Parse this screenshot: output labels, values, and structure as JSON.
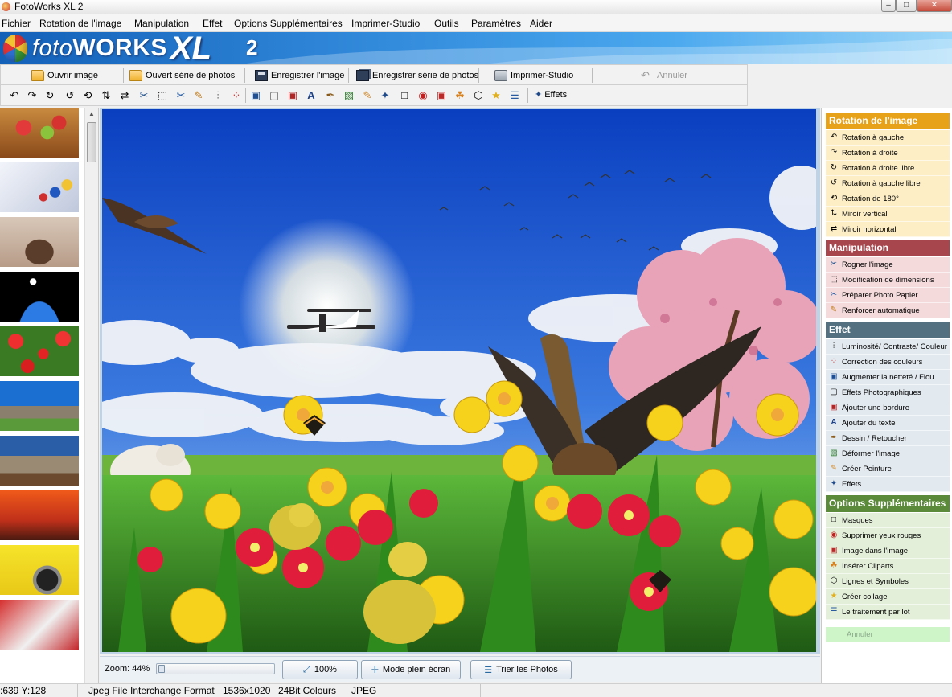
{
  "window": {
    "title": "FotoWorks XL 2",
    "controls": [
      "–",
      "□",
      "✕"
    ]
  },
  "menu": [
    "Fichier",
    "Rotation de l'image",
    "Manipulation",
    "Effet",
    "Options Supplémentaires",
    "Imprimer-Studio",
    "Outils",
    "Paramètres",
    "Aider"
  ],
  "brand": {
    "logo_light": "foto",
    "logo_bold": "WORKS",
    "logo_xl": "XL",
    "logo_version": "2"
  },
  "toolbar": {
    "open_image": "Ouvrir image",
    "open_series": "Ouvert série de photos",
    "save_image": "Enregistrer l'image",
    "save_series": "Enregistrer série de photos",
    "print_studio": "Imprimer-Studio",
    "undo": "Annuler",
    "effects": "Effets"
  },
  "tools_icons": [
    "rotate-left",
    "rotate-right",
    "rotate-free-right",
    "rotate-free-left",
    "rotate-180",
    "mirror-vertical",
    "mirror-horizontal",
    "crop",
    "resize",
    "prepare-photo-paper",
    "auto-enhance",
    "brightness",
    "color-correction",
    "sharpen",
    "photo-effects",
    "border",
    "text",
    "draw-retouch",
    "distort",
    "paint",
    "masks",
    "red-eye",
    "picture-in-picture",
    "cliparts",
    "lines-symbols",
    "collage",
    "batch"
  ],
  "zoom": {
    "label": "Zoom: 44%",
    "level_percent": 44,
    "btn_100": "100%",
    "btn_fullscreen": "Mode plein écran",
    "btn_sort": "Trier les Photos"
  },
  "panel": {
    "rotation": {
      "title": "Rotation de l'image",
      "color": "#e8a21a",
      "item_bg": "#fdeec5",
      "items": [
        "Rotation à gauche",
        "Rotation à droite",
        "Rotation à droite libre",
        "Rotation à gauche libre",
        "Rotation de 180°",
        "Miroir vertical",
        "Miroir horizontal"
      ]
    },
    "manipulation": {
      "title": "Manipulation",
      "color": "#a8464d",
      "item_bg": "#f4dadb",
      "items": [
        "Rogner l'image",
        "Modification de dimensions",
        "Préparer Photo Papier",
        "Renforcer automatique"
      ]
    },
    "effet": {
      "title": "Effet",
      "color": "#52707f",
      "item_bg": "#e2e9ef",
      "items": [
        "Luminosité/ Contraste/ Couleur",
        "Correction des couleurs",
        "Augmenter la netteté / Flou",
        "Effets Photographiques",
        "Ajouter une bordure",
        "Ajouter du texte",
        "Dessin / Retoucher",
        "Déformer l'image",
        "Créer Peinture",
        "Effets"
      ]
    },
    "options": {
      "title": "Options Supplémentaires",
      "color": "#5a8a3a",
      "item_bg": "#e3efd9",
      "items": [
        "Masques",
        "Supprimer yeux rouges",
        "Image dans l'image",
        "Insérer Cliparts",
        "Lignes et Symboles",
        "Créer collage",
        "Le traitement par lot"
      ]
    },
    "undo": "Annuler"
  },
  "status": {
    "coords": ":639 Y:128",
    "format": "Jpeg File Interchange Format",
    "size": "1536x1020",
    "depth": "24Bit Colours",
    "type": "JPEG"
  }
}
